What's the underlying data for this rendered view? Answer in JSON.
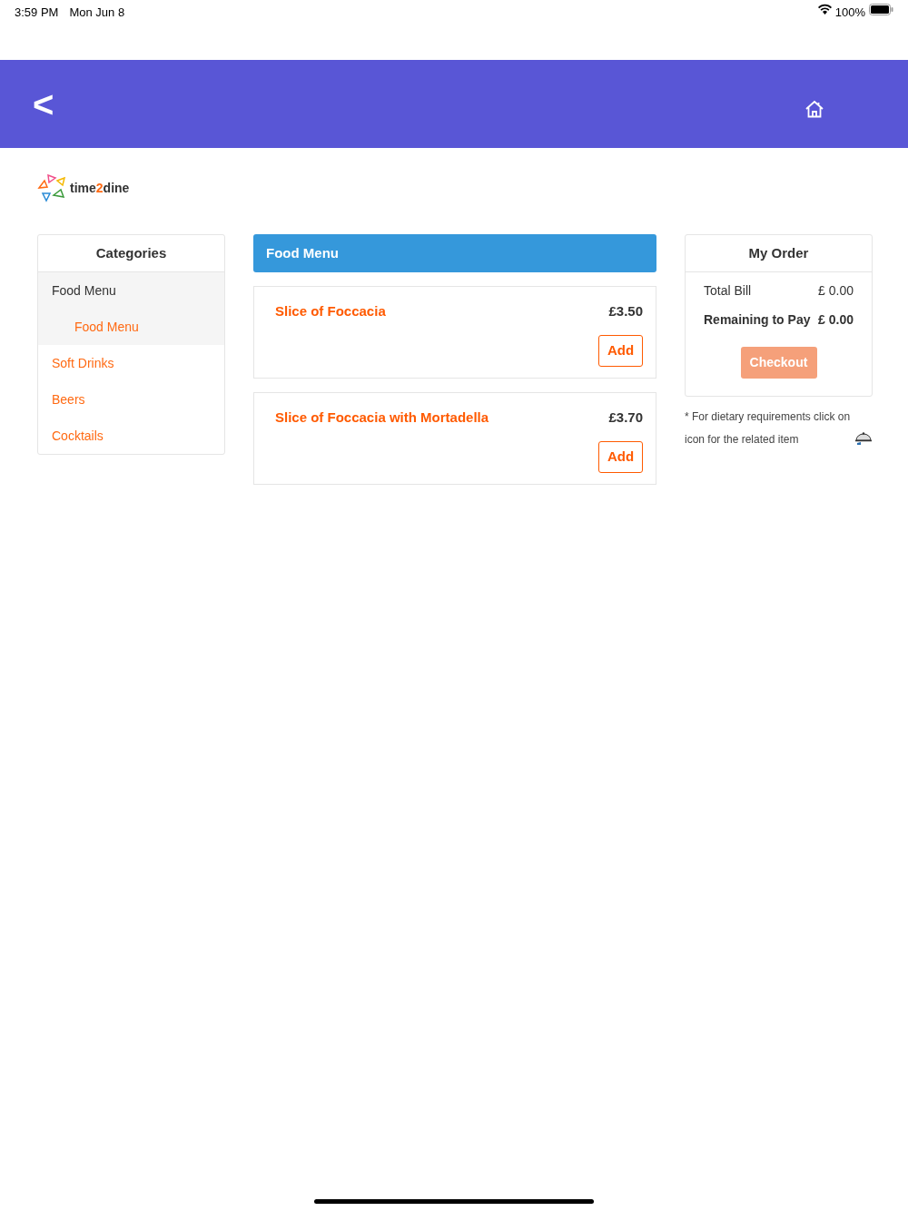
{
  "status_bar": {
    "time": "3:59 PM",
    "date": "Mon Jun 8",
    "battery": "100%"
  },
  "header": {
    "back": "<"
  },
  "logo": {
    "parts": [
      {
        "text": "time",
        "color": "#333333"
      },
      {
        "text": "2",
        "color": "#ff6a13"
      },
      {
        "text": "dine",
        "color": "#333333"
      }
    ]
  },
  "categories": {
    "title": "Categories",
    "items": [
      {
        "label": "Food Menu",
        "expanded": true,
        "children": [
          {
            "label": "Food Menu"
          }
        ]
      },
      {
        "label": "Soft Drinks",
        "expanded": false
      },
      {
        "label": "Beers",
        "expanded": false
      },
      {
        "label": "Cocktails",
        "expanded": false
      }
    ]
  },
  "menu": {
    "title": "Food Menu",
    "items": [
      {
        "name": "Slice of Foccacia",
        "price": "£3.50",
        "button": "Add"
      },
      {
        "name": "Slice of Foccacia with Mortadella",
        "price": "£3.70",
        "button": "Add"
      }
    ]
  },
  "order": {
    "title": "My Order",
    "rows": [
      {
        "label": "Total Bill",
        "value": "£ 0.00",
        "emphasized": false
      },
      {
        "label": "Remaining to Pay",
        "value": "£ 0.00",
        "emphasized": true
      }
    ],
    "checkout": {
      "label": "Checkout",
      "disabled": true
    },
    "note": "* For dietary requirements click on icon for the related item"
  }
}
